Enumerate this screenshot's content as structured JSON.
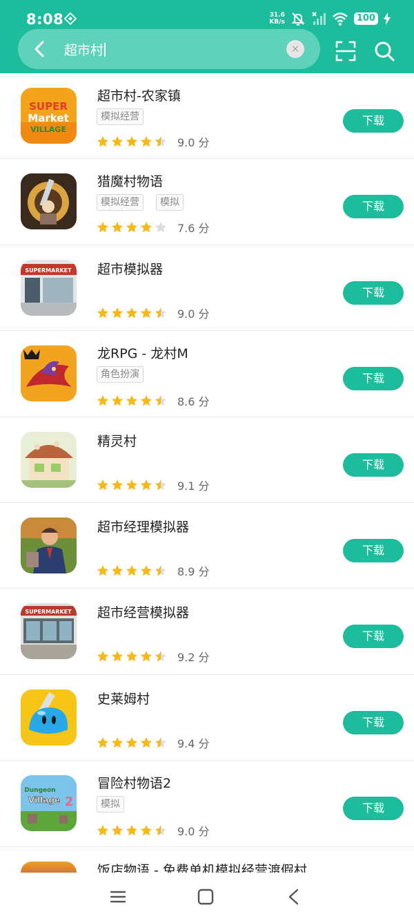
{
  "status_bar": {
    "time": "8:08",
    "net_speed_value": "31.6",
    "net_speed_unit": "KB/s",
    "battery": "100"
  },
  "search": {
    "query": "超市村",
    "clear_symbol": "×"
  },
  "colors": {
    "accent": "#1dbc9c",
    "star_on": "#f7b918",
    "star_off": "#dddddd"
  },
  "apps": [
    {
      "name": "超市村-农家镇",
      "tags": [
        "模拟经营"
      ],
      "score": "9.0 分",
      "stars": 4.5,
      "button": "下载"
    },
    {
      "name": "猎魔村物语",
      "tags": [
        "模拟经营",
        "模拟"
      ],
      "score": "7.6 分",
      "stars": 4,
      "button": "下载"
    },
    {
      "name": "超市模拟器",
      "tags": [],
      "score": "9.0 分",
      "stars": 4.5,
      "button": "下载"
    },
    {
      "name": "龙RPG - 龙村M",
      "tags": [
        "角色扮演"
      ],
      "score": "8.6 分",
      "stars": 4.5,
      "button": "下载"
    },
    {
      "name": "精灵村",
      "tags": [],
      "score": "9.1 分",
      "stars": 4.5,
      "button": "下载"
    },
    {
      "name": "超市经理模拟器",
      "tags": [],
      "score": "8.9 分",
      "stars": 4.5,
      "button": "下载"
    },
    {
      "name": "超市经营模拟器",
      "tags": [],
      "score": "9.2 分",
      "stars": 4.5,
      "button": "下载"
    },
    {
      "name": "史莱姆村",
      "tags": [],
      "score": "9.4 分",
      "stars": 4.5,
      "button": "下载"
    },
    {
      "name": "冒险村物语2",
      "tags": [
        "模拟"
      ],
      "score": "9.0 分",
      "stars": 4.5,
      "button": "下载"
    }
  ],
  "partial_app": {
    "name": "饭店物语 - 免费单机模拟经营渡假村"
  }
}
